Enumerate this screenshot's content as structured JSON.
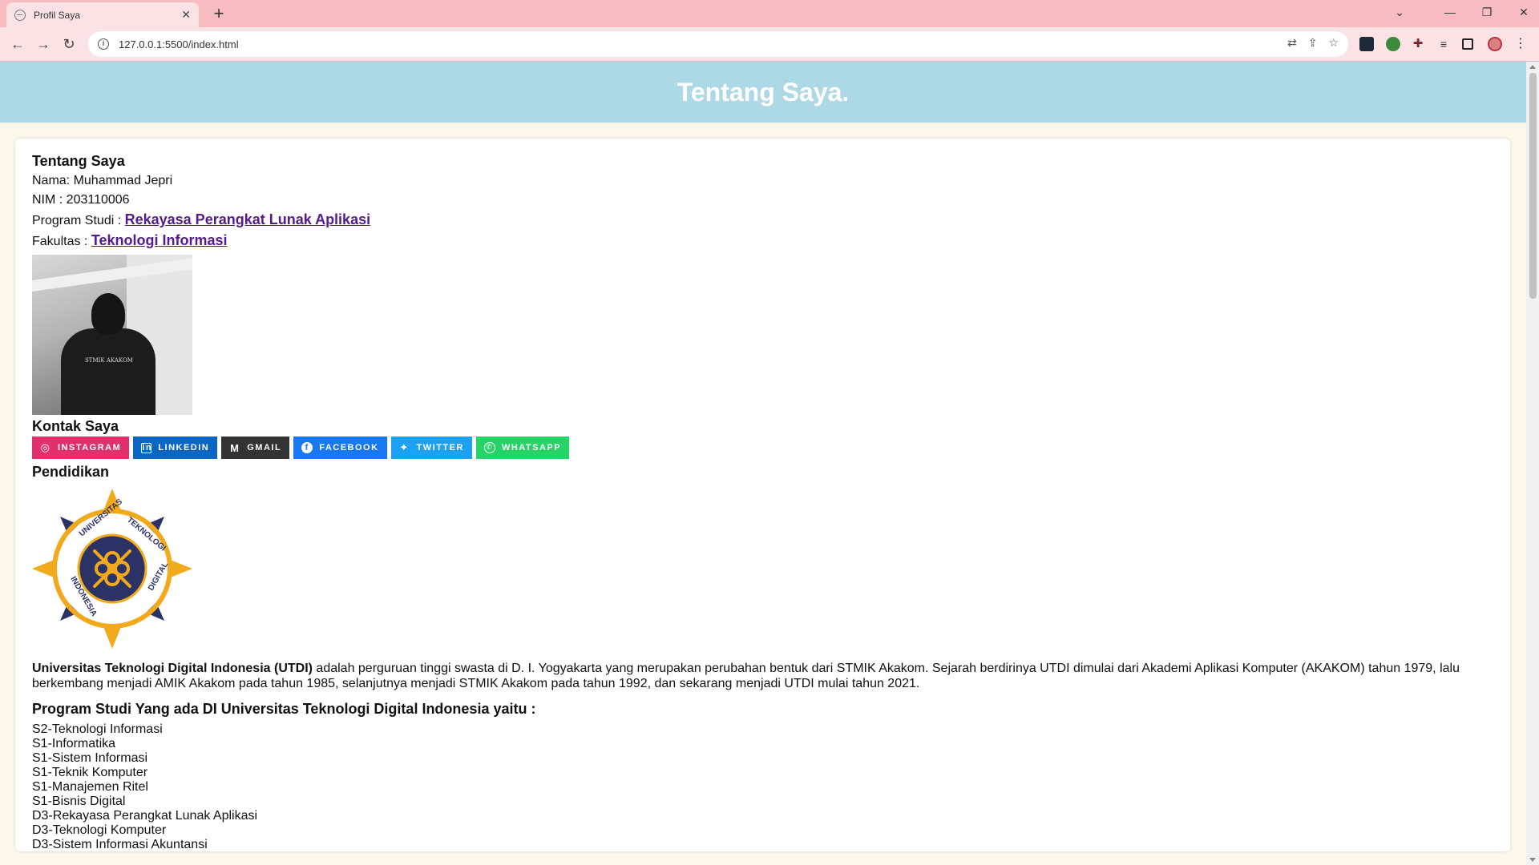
{
  "browser": {
    "tab_title": "Profil Saya",
    "tab_close": "✕",
    "new_tab": "+",
    "url": "127.0.0.1:5500/index.html",
    "window_controls": [
      "⌄",
      "—",
      "❐",
      "✕"
    ],
    "nav": {
      "back": "←",
      "forward": "→",
      "reload": "↻"
    },
    "omnibox_icons": [
      "⇄",
      "⇪",
      "☆"
    ],
    "menu": "⋮"
  },
  "header": {
    "title": "Tentang Saya."
  },
  "about": {
    "heading": "Tentang Saya",
    "nama_label": "Nama: Muhammad Jepri",
    "nim_label": "NIM : 203110006",
    "prodi_label": "Program Studi : ",
    "prodi_link": "Rekayasa Perangkat Lunak Aplikasi",
    "fakultas_label": "Fakultas : ",
    "fakultas_link": "Teknologi Informasi",
    "photo_text": "STMIK AKAKOM"
  },
  "contact": {
    "heading": "Kontak Saya",
    "buttons": [
      {
        "label": "INSTAGRAM",
        "icon": "instagram-icon",
        "color": "#e1306c"
      },
      {
        "label": "LINKEDIN",
        "icon": "linkedin-icon",
        "color": "#0a66c2"
      },
      {
        "label": "GMAIL",
        "icon": "gmail-icon",
        "color": "#333333"
      },
      {
        "label": "FACEBOOK",
        "icon": "facebook-icon",
        "color": "#1877f2"
      },
      {
        "label": "TWITTER",
        "icon": "twitter-icon",
        "color": "#1da1f2"
      },
      {
        "label": "WHATSAPP",
        "icon": "whatsapp-icon",
        "color": "#25d366"
      }
    ]
  },
  "education": {
    "heading": "Pendidikan",
    "logo_top": "UNIVERSITAS",
    "logo_right": "TEKNOLOGI",
    "logo_bottom_right": "DIGITAL",
    "logo_bottom_left": "INDONESIA",
    "desc_bold": "Universitas Teknologi Digital Indonesia (UTDI)",
    "desc_rest": " adalah perguruan tinggi swasta di D. I. Yogyakarta yang merupakan perubahan bentuk dari STMIK Akakom. Sejarah berdirinya UTDI dimulai dari Akademi Aplikasi Komputer (AKAKOM) tahun 1979, lalu berkembang menjadi AMIK Akakom pada tahun 1985, selanjutnya menjadi STMIK Akakom pada tahun 1992, dan sekarang menjadi UTDI mulai tahun 2021.",
    "prodi_title": "Program Studi Yang ada DI Universitas Teknologi Digital Indonesia yaitu :",
    "prodi": [
      "S2-Teknologi Informasi",
      "S1-Informatika",
      "S1-Sistem Informasi",
      "S1-Teknik Komputer",
      "S1-Manajemen Ritel",
      "S1-Bisnis Digital",
      "D3-Rekayasa Perangkat Lunak Aplikasi",
      "D3-Teknologi Komputer",
      "D3-Sistem Informasi Akuntansi"
    ]
  }
}
